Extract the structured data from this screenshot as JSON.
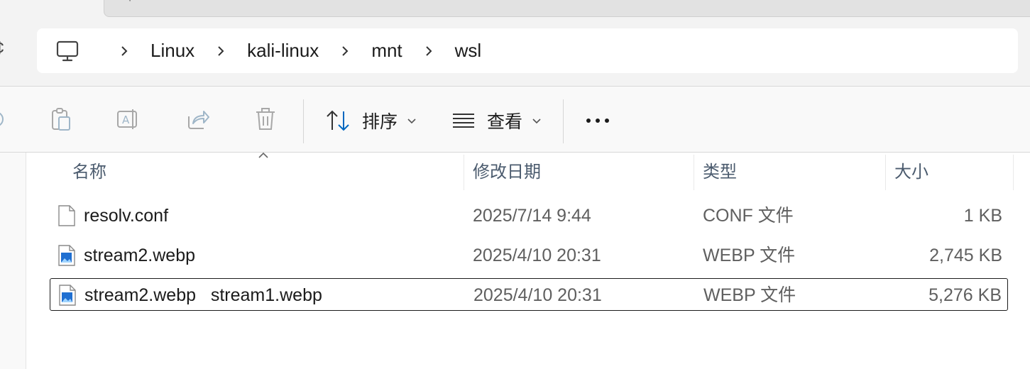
{
  "breadcrumb": {
    "items": [
      "Linux",
      "kali-linux",
      "mnt",
      "wsl"
    ]
  },
  "toolbar": {
    "sort_label": "排序",
    "view_label": "查看"
  },
  "columns": {
    "name": "名称",
    "modified": "修改日期",
    "type": "类型",
    "size": "大小"
  },
  "files": [
    {
      "name": "resolv.conf",
      "modified": "2025/7/14 9:44",
      "type": "CONF 文件",
      "size": "1 KB",
      "icon": "text-file-icon"
    },
    {
      "name": "stream2.webp",
      "modified": "2025/4/10 20:31",
      "type": "WEBP 文件",
      "size": "2,745 KB",
      "icon": "image-file-icon"
    },
    {
      "name": "stream2.webp   stream1.webp",
      "modified": "2025/4/10 20:31",
      "type": "WEBP 文件",
      "size": "5,276 KB",
      "icon": "image-file-icon"
    }
  ],
  "colors": {
    "accent": "#0067c0",
    "header_text": "#4b5b6e",
    "secondary_text": "#5f5f5f"
  }
}
